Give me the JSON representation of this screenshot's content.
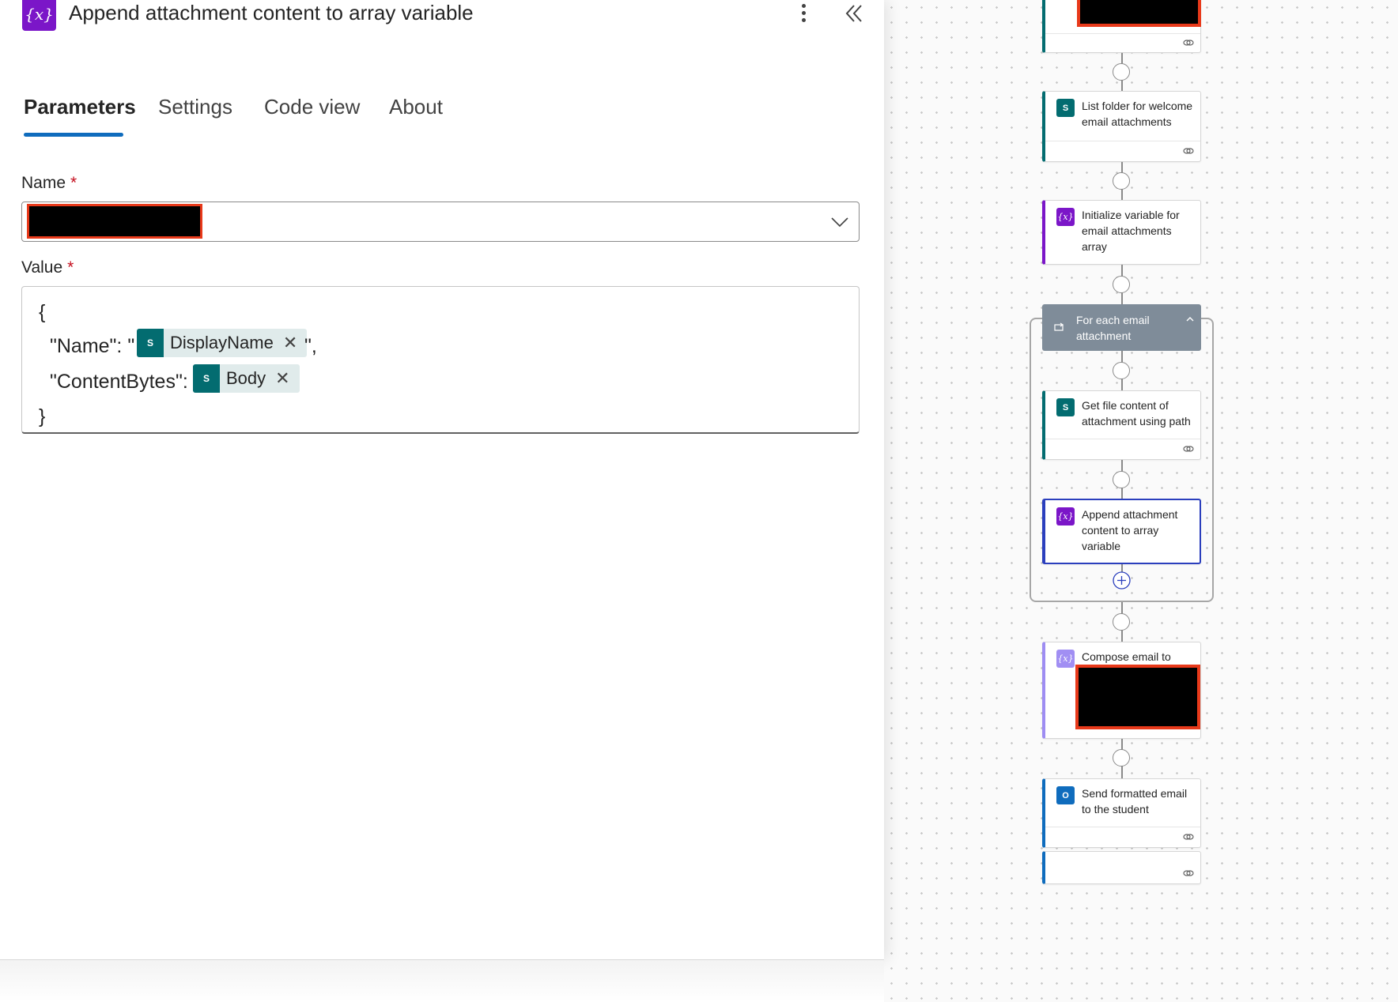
{
  "panel": {
    "icon_text": "{x}",
    "title": "Append attachment content to array variable",
    "tabs": [
      "Parameters",
      "Settings",
      "Code view",
      "About"
    ],
    "active_tab": "Parameters",
    "name_field": {
      "label": "Name",
      "required_mark": "*",
      "value": ""
    },
    "value_field": {
      "label": "Value",
      "required_mark": "*",
      "line_open": "{",
      "name_key": "\"Name\": \"",
      "name_suffix": "\",",
      "name_token": "DisplayName",
      "content_key": "\"ContentBytes\":",
      "content_token": "Body",
      "line_close": "}"
    },
    "token_icon_text": "S",
    "token_remove": "✕"
  },
  "flow": {
    "steps": [
      {
        "title": "List folder for welcome email attachments",
        "connector": "sharepoint"
      },
      {
        "title": "Initialize variable for email attachments array",
        "connector": "variable"
      },
      {
        "title": "For each email attachment",
        "connector": "loop"
      },
      {
        "title": "Get file content of attachment using path",
        "connector": "sharepoint"
      },
      {
        "title": "Append attachment content to array variable",
        "connector": "variable",
        "selected": true
      },
      {
        "title": "Compose email to",
        "connector": "compose"
      },
      {
        "title": "Send formatted email to the student",
        "connector": "outlook"
      }
    ],
    "icons": {
      "sharepoint": "S",
      "variable": "{x}",
      "compose": "{x}",
      "outlook": "O"
    }
  },
  "colors": {
    "accent": "#0f6cbd",
    "variable": "#7b16c8",
    "sharepoint": "#036c70",
    "required": "#c50f1f",
    "redaction_border": "#e8391a"
  }
}
